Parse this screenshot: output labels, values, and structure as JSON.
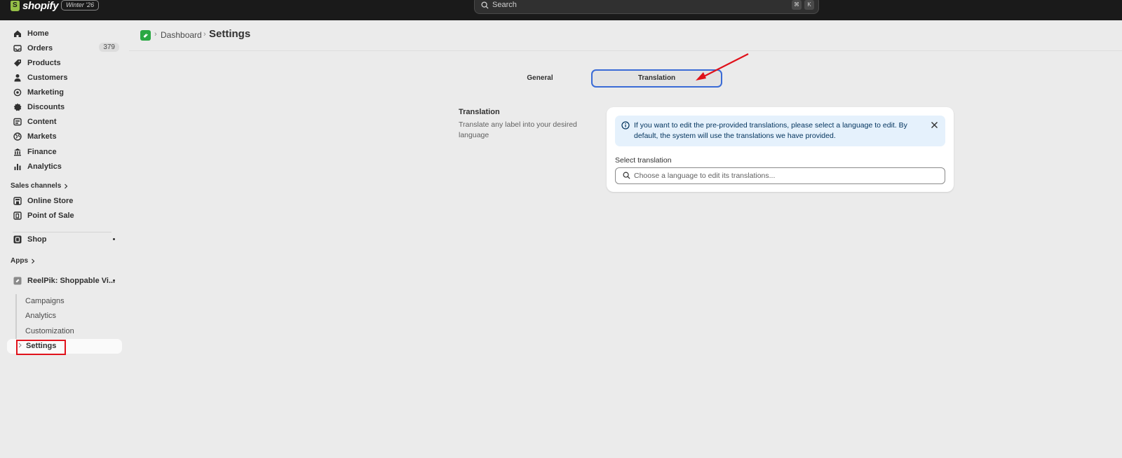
{
  "topbar": {
    "logo_text": "shopify",
    "edition": "Winter '26",
    "search_placeholder": "Search",
    "shortcut_keys": [
      "⌘",
      "K"
    ]
  },
  "sidebar": {
    "items": [
      {
        "label": "Home",
        "icon": "home-icon"
      },
      {
        "label": "Orders",
        "icon": "inbox-icon",
        "badge": "379"
      },
      {
        "label": "Products",
        "icon": "tag-icon"
      },
      {
        "label": "Customers",
        "icon": "person-icon"
      },
      {
        "label": "Marketing",
        "icon": "target-icon"
      },
      {
        "label": "Discounts",
        "icon": "discount-icon"
      },
      {
        "label": "Content",
        "icon": "content-icon"
      },
      {
        "label": "Markets",
        "icon": "globe-icon"
      },
      {
        "label": "Finance",
        "icon": "bank-icon"
      },
      {
        "label": "Analytics",
        "icon": "bar-chart-icon"
      }
    ],
    "sales_channels_label": "Sales channels",
    "channels": [
      {
        "label": "Online Store",
        "icon": "store-icon"
      },
      {
        "label": "Point of Sale",
        "icon": "pos-icon"
      }
    ],
    "shop_label": "Shop",
    "apps_label": "Apps",
    "app_name": "ReelPik: Shoppable Vi...",
    "app_subitems": [
      "Campaigns",
      "Analytics",
      "Customization",
      "Settings"
    ]
  },
  "header": {
    "breadcrumb_dashboard": "Dashboard",
    "page_title": "Settings"
  },
  "tabs": [
    {
      "label": "General"
    },
    {
      "label": "Translation",
      "active": true
    }
  ],
  "section": {
    "title": "Translation",
    "description": "Translate any label into your desired language"
  },
  "card": {
    "banner_text": "If you want to edit the pre-provided translations, please select a language to edit. By default, the system will use the translations we have provided.",
    "field_label": "Select translation",
    "field_placeholder": "Choose a language to edit its translations..."
  },
  "colors": {
    "topbar": "#1a1a1a",
    "accent_focus": "#3a6bd6",
    "annotation_red": "#e0121b",
    "banner_bg": "#e5f1fc",
    "app_green": "#2aa843"
  }
}
